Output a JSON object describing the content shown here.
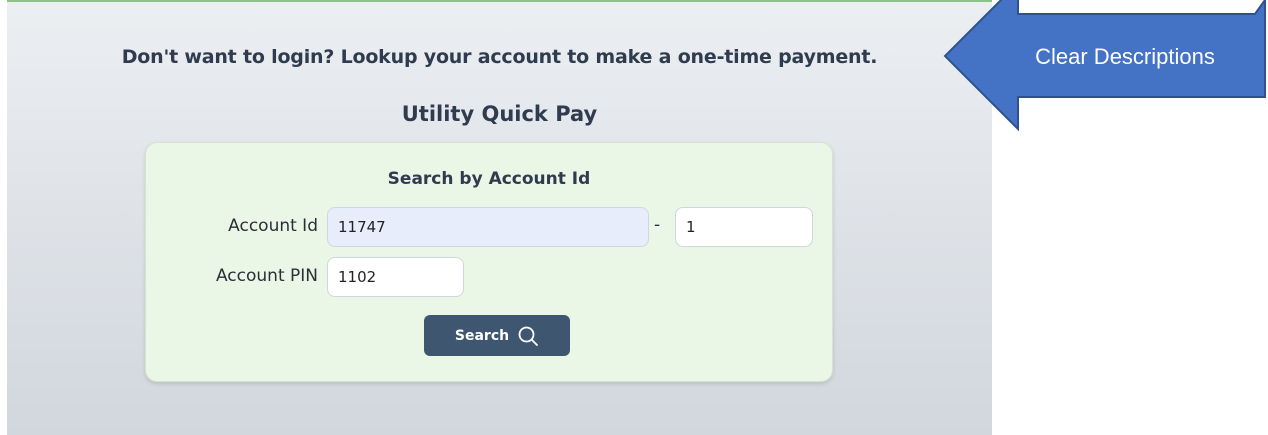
{
  "page": {
    "headline": "Don't want to login? Lookup your account to make a one-time payment.",
    "subtitle": "Utility Quick Pay"
  },
  "search_card": {
    "title": "Search by Account Id",
    "account_id_label": "Account Id",
    "account_id_value": "11747",
    "separator": "-",
    "account_suffix_value": "1",
    "pin_label": "Account PIN",
    "pin_value": "1102",
    "search_button_label": "Search",
    "search_icon": "search-icon"
  },
  "annotation": {
    "callout_text": "Clear Descriptions",
    "arrow_fill": "#4472c4",
    "arrow_stroke": "#2f528f"
  },
  "colors": {
    "button": "#3e5670",
    "card_bg": "#eaf6e6",
    "text": "#2f3b4e"
  }
}
